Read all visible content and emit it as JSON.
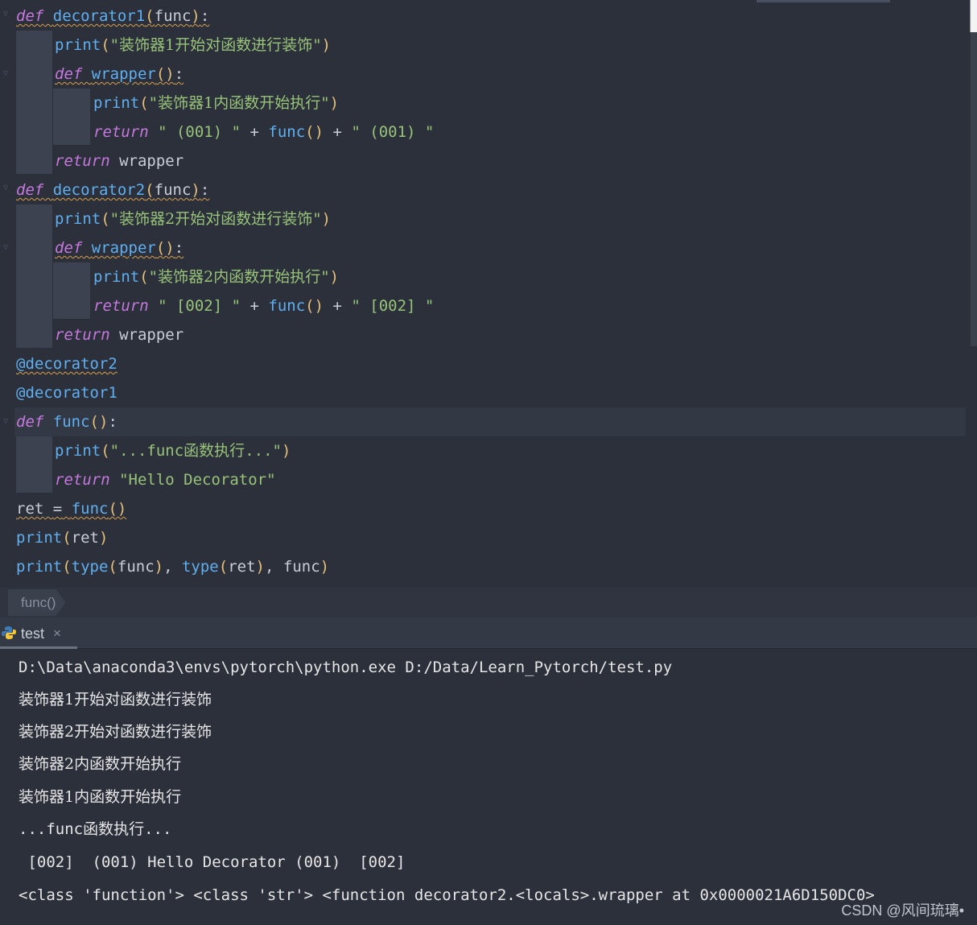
{
  "editor": {
    "lines": [
      {
        "id": "l1"
      },
      {
        "id": "l2"
      }
    ],
    "code": {
      "def": "def",
      "return": "return",
      "print": "print",
      "type": "type",
      "decorator1": "decorator1",
      "decorator2": "decorator2",
      "wrapper": "wrapper",
      "func": "func",
      "ret": "ret",
      "s_deco1_start": "装饰器1开始对函数进行装饰",
      "s_deco1_inner": "装饰器1内函数开始执行",
      "s_deco2_start": "装饰器2开始对函数进行装饰",
      "s_deco2_inner": "装饰器2内函数开始执行",
      "s_001": "\" (001) \"",
      "s_002": "\" [002] \"",
      "s_func_exec_pre": "\"...func",
      "s_func_exec_cjk": "函数执行",
      "s_func_exec_post": "...\"",
      "s_hello": "\"Hello Decorator\"",
      "at_decorator2": "@decorator2",
      "at_decorator1": "@decorator1"
    }
  },
  "breadcrumb": {
    "item": "func()"
  },
  "run_panel": {
    "tab_label": "test",
    "tab_close": "×",
    "output": [
      "D:\\Data\\anaconda3\\envs\\pytorch\\python.exe D:/Data/Learn_Pytorch/test.py",
      "装饰器1开始对函数进行装饰",
      "装饰器2开始对函数进行装饰",
      "装饰器2内函数开始执行",
      "装饰器1内函数开始执行",
      "...func函数执行...",
      " [002]  (001) Hello Decorator (001)  [002]",
      "<class 'function'> <class 'str'> <function decorator2.<locals>.wrapper at 0x0000021A6D150DC0>"
    ]
  },
  "watermark": "CSDN @风间琉璃•",
  "colors": {
    "background": "#2b303b",
    "keyword": "#c678dd",
    "function": "#61afef",
    "string": "#98c379",
    "paren": "#e5c07b"
  }
}
